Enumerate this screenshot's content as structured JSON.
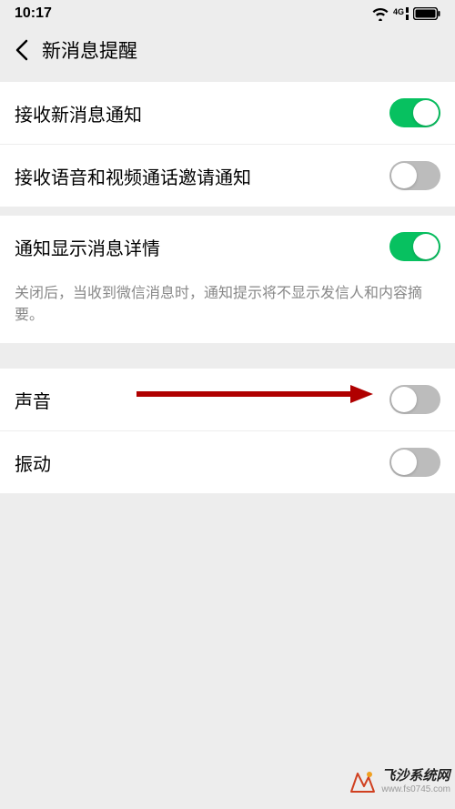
{
  "status": {
    "time": "10:17",
    "network_label": "4G"
  },
  "nav": {
    "title": "新消息提醒"
  },
  "rows": {
    "receive_new": {
      "label": "接收新消息通知",
      "on": true
    },
    "receive_call": {
      "label": "接收语音和视频通话邀请通知",
      "on": false
    },
    "show_detail": {
      "label": "通知显示消息详情",
      "on": true
    },
    "show_detail_desc": "关闭后，当收到微信消息时，通知提示将不显示发信人和内容摘要。",
    "sound": {
      "label": "声音",
      "on": false
    },
    "vibrate": {
      "label": "振动",
      "on": false
    }
  },
  "watermark": {
    "main": "飞沙系统网",
    "sub": "www.fs0745.com"
  }
}
